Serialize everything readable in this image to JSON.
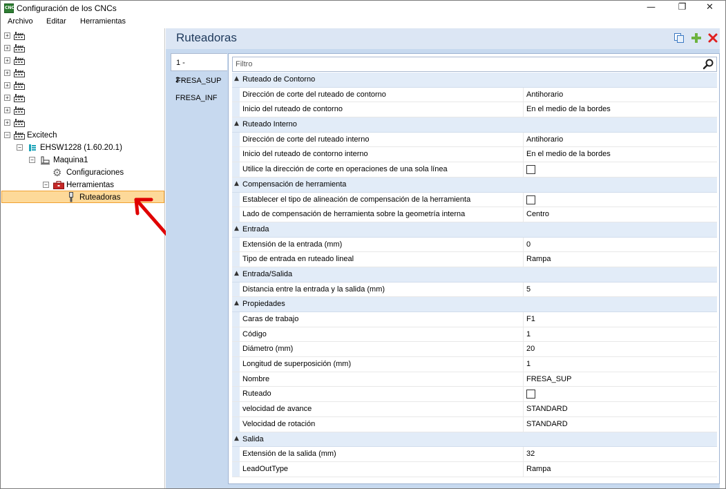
{
  "window": {
    "title": "Configuración de los CNCs",
    "icon_text": "CNC",
    "minimize": "—",
    "maximize": "❐",
    "close": "✕"
  },
  "menu": [
    "Archivo",
    "Editar",
    "Herramientas"
  ],
  "tree": {
    "collapsed_nodes_count_icon": "factory-icon",
    "expander_collapsed": "+",
    "expander_expanded": "−",
    "excitech": "Excitech",
    "ehsw": "EHSW1228 (1.60.20.1)",
    "maquina": "Maquina1",
    "configuraciones": "Configuraciones",
    "herramientas": "Herramientas",
    "ruteadoras": "Ruteadoras"
  },
  "panel": {
    "title": "Ruteadoras",
    "tabs": [
      "1 - FRESA_SUP",
      "2 - FRESA_INF"
    ],
    "filter_placeholder": "Filtro"
  },
  "grid": [
    {
      "category": "Ruteado de Contorno",
      "rows": [
        {
          "name": "Dirección de corte del ruteado de contorno",
          "value": "Antihorario"
        },
        {
          "name": "Inicio del ruteado de contorno",
          "value": "En el medio de la bordes"
        }
      ]
    },
    {
      "category": "Ruteado Interno",
      "rows": [
        {
          "name": "Dirección de corte del ruteado interno",
          "value": "Antihorario"
        },
        {
          "name": "Inicio del ruteado de contorno interno",
          "value": "En el medio de la bordes"
        },
        {
          "name": "Utilice la dirección de corte en operaciones de una sola línea",
          "value": "",
          "checkbox": true
        }
      ]
    },
    {
      "category": "Compensación de herramienta",
      "rows": [
        {
          "name": "Establecer el tipo de alineación de compensación de la herramienta",
          "value": "",
          "checkbox": true
        },
        {
          "name": "Lado de compensación de herramienta sobre la geometría interna",
          "value": "Centro"
        }
      ]
    },
    {
      "category": "Entrada",
      "rows": [
        {
          "name": "Extensión de la entrada (mm)",
          "value": "0"
        },
        {
          "name": "Tipo de entrada en ruteado lineal",
          "value": "Rampa"
        }
      ]
    },
    {
      "category": "Entrada/Salida",
      "rows": [
        {
          "name": "Distancia entre la entrada y la salida (mm)",
          "value": "5"
        }
      ]
    },
    {
      "category": "Propiedades",
      "rows": [
        {
          "name": "Caras de trabajo",
          "value": "F1"
        },
        {
          "name": "Código",
          "value": "1"
        },
        {
          "name": "Diámetro (mm)",
          "value": "20"
        },
        {
          "name": "Longitud de superposición (mm)",
          "value": "1"
        },
        {
          "name": "Nombre",
          "value": "FRESA_SUP"
        },
        {
          "name": "Ruteado",
          "value": "",
          "checkbox": true
        },
        {
          "name": "velocidad de avance",
          "value": "STANDARD"
        },
        {
          "name": "Velocidad de rotación",
          "value": "STANDARD"
        }
      ]
    },
    {
      "category": "Salida",
      "rows": [
        {
          "name": "Extensión de la salida (mm)",
          "value": "32"
        },
        {
          "name": "LeadOutType",
          "value": "Rampa"
        }
      ]
    }
  ],
  "colors": {
    "header_bg": "#dce6f4",
    "body_bg": "#c7d9ef",
    "selection_bg": "#fdd999",
    "selection_border": "#f0a030",
    "arrow": "#e00000"
  }
}
